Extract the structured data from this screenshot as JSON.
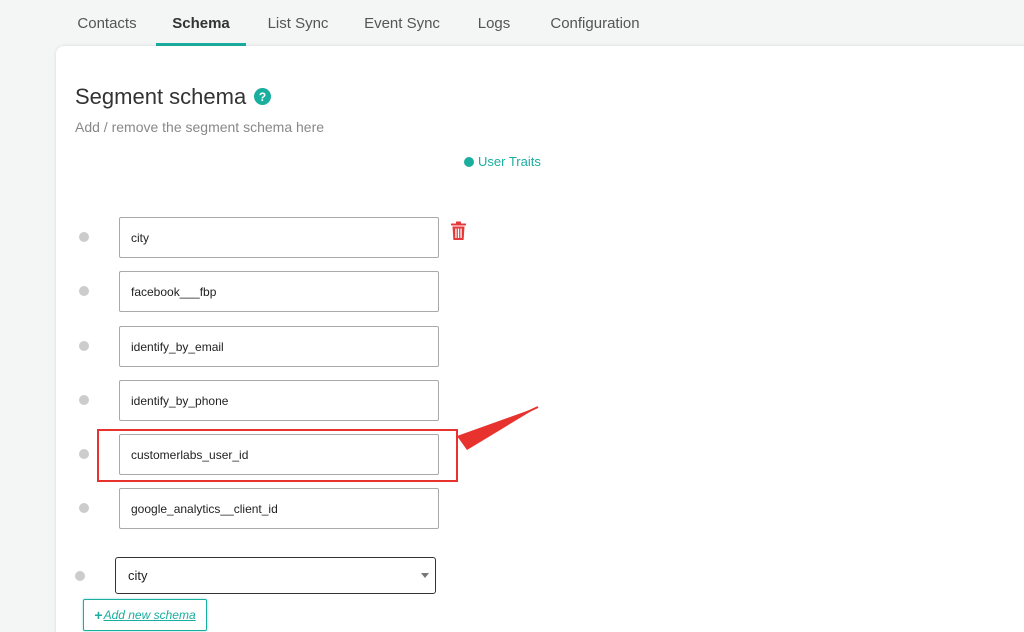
{
  "tabs": [
    {
      "label": "Contacts"
    },
    {
      "label": "Schema",
      "active": true
    },
    {
      "label": "List Sync"
    },
    {
      "label": "Event Sync"
    },
    {
      "label": "Logs"
    },
    {
      "label": "Configuration"
    }
  ],
  "header": {
    "title": "Segment schema",
    "help_icon": "?",
    "subtitle": "Add / remove the segment schema here"
  },
  "legend": {
    "label": "User Traits"
  },
  "schema_fields": [
    {
      "value": "city"
    },
    {
      "value": "facebook___fbp"
    },
    {
      "value": "identify_by_email"
    },
    {
      "value": "identify_by_phone"
    },
    {
      "value": "customerlabs_user_id"
    },
    {
      "value": "google_analytics__client_id"
    }
  ],
  "new_schema_select": {
    "selected": "city"
  },
  "add_button": {
    "plus": "+",
    "label": "Add new schema"
  },
  "colors": {
    "accent": "#1aae9f",
    "trash": "#e5383b",
    "annotation": "#e8322e"
  },
  "icons": {
    "help": "question-circle-icon",
    "trash": "trash-icon",
    "caret": "caret-down-icon"
  }
}
